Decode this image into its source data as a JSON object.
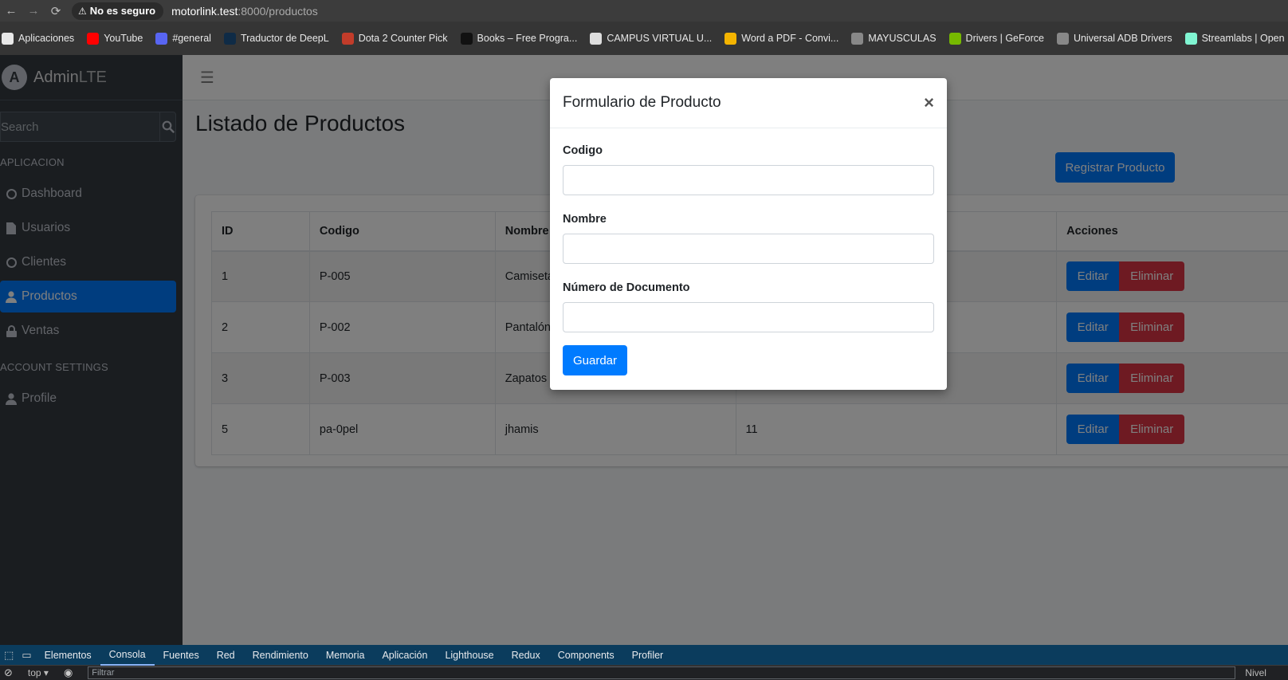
{
  "browser": {
    "security_label": "No es seguro",
    "url_host": "motorlink.test",
    "url_path": ":8000/productos",
    "bookmarks": [
      {
        "label": "Aplicaciones",
        "color": "#e8e8e8"
      },
      {
        "label": "YouTube",
        "color": "#ff0000"
      },
      {
        "label": "#general",
        "color": "#5865f2"
      },
      {
        "label": "Traductor de DeepL",
        "color": "#0f2b46"
      },
      {
        "label": "Dota 2 Counter Pick",
        "color": "#c23c2a"
      },
      {
        "label": "Books – Free Progra...",
        "color": "#111111"
      },
      {
        "label": "CAMPUS VIRTUAL U...",
        "color": "#dddddd"
      },
      {
        "label": "Word a PDF - Convi...",
        "color": "#f4b400"
      },
      {
        "label": "MAYUSCULAS",
        "color": "#888888"
      },
      {
        "label": "Drivers | GeForce",
        "color": "#76b900"
      },
      {
        "label": "Universal ADB Drivers",
        "color": "#888888"
      },
      {
        "label": "Streamlabs | Open B...",
        "color": "#80f5d2"
      }
    ]
  },
  "sidebar": {
    "brand_bold": "Admin",
    "brand_light": "LTE",
    "search_placeholder": "Search",
    "header_app": "APLICACION",
    "items": [
      {
        "label": "Dashboard"
      },
      {
        "label": "Usuarios"
      },
      {
        "label": "Clientes"
      },
      {
        "label": "Productos"
      },
      {
        "label": "Ventas"
      }
    ],
    "header_account": "ACCOUNT SETTINGS",
    "profile_label": "Profile"
  },
  "main": {
    "title": "Listado de Productos",
    "register_button": "Registrar Producto",
    "table": {
      "headers": [
        "ID",
        "Codigo",
        "Nombre",
        "",
        "Acciones"
      ],
      "rows": [
        {
          "id": "1",
          "codigo": "P-005",
          "nombre": "Camiseta",
          "extra": ""
        },
        {
          "id": "2",
          "codigo": "P-002",
          "nombre": "Pantalón",
          "extra": ""
        },
        {
          "id": "3",
          "codigo": "P-003",
          "nombre": "Zapatos",
          "extra": ""
        },
        {
          "id": "5",
          "codigo": "pa-0pel",
          "nombre": "jhamis",
          "extra": "11"
        }
      ],
      "edit_label": "Editar",
      "delete_label": "Eliminar"
    }
  },
  "modal": {
    "title": "Formulario de Producto",
    "close_symbol": "×",
    "fields": [
      {
        "label": "Codigo",
        "value": ""
      },
      {
        "label": "Nombre",
        "value": ""
      },
      {
        "label": "Número de Documento",
        "value": ""
      }
    ],
    "save_button": "Guardar"
  },
  "devtools": {
    "tabs": [
      "Elementos",
      "Consola",
      "Fuentes",
      "Red",
      "Rendimiento",
      "Memoria",
      "Aplicación",
      "Lighthouse",
      "Redux",
      "Components",
      "Profiler"
    ],
    "active_tab": "Consola",
    "context": "top",
    "filter_placeholder": "Filtrar",
    "levels_label": "Nivel"
  },
  "colors": {
    "primary": "#007bff",
    "danger": "#dc3545",
    "sidebar_bg": "#343a40"
  }
}
